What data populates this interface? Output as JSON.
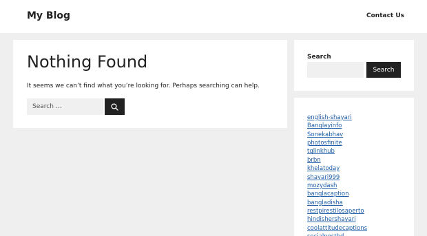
{
  "header": {
    "site_title": "My Blog",
    "nav": [
      {
        "label": "Contact Us"
      }
    ]
  },
  "main": {
    "title": "Nothing Found",
    "text": "It seems we can’t find what you’re looking for. Perhaps searching can help.",
    "search": {
      "placeholder": "Search …",
      "button_icon": "search-icon"
    }
  },
  "sidebar": {
    "search_widget": {
      "title": "Search",
      "button_label": "Search"
    },
    "links": [
      "english-shayari",
      "Banglayinfo",
      "Sonekabhav",
      "photosfinite",
      "tglinkhub",
      "brbn",
      "khelatoday",
      "shayari999",
      "mozydash",
      "banglacaption",
      "bangladisha",
      "restpirestilosaperto",
      "hindishershayari",
      "coolattitudecaptions",
      "socialpostbd"
    ]
  },
  "colors": {
    "background": "#efefef",
    "panel": "#ffffff",
    "accent_dark": "#222222",
    "link": "#1e5ea8"
  }
}
